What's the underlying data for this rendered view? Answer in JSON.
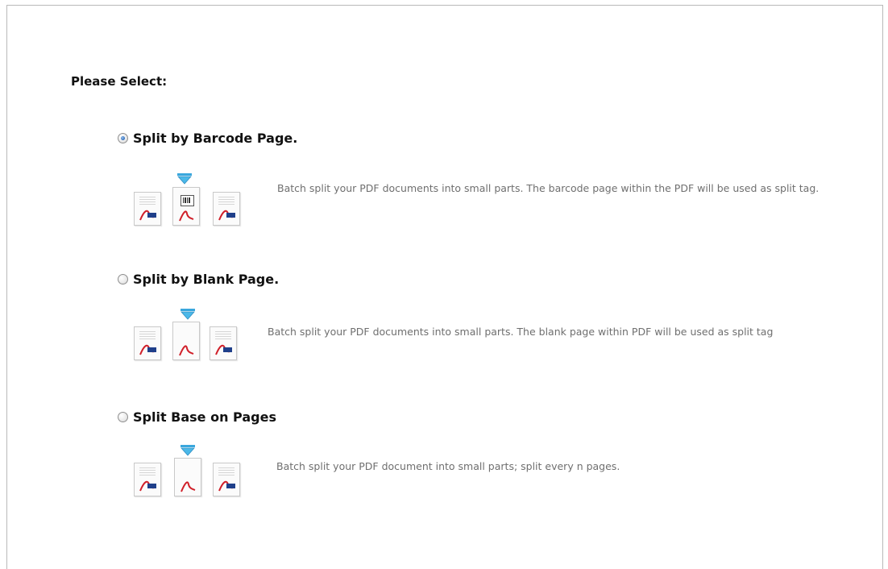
{
  "heading": "Please Select:",
  "options": [
    {
      "label": "Split by Barcode Page.",
      "selected": true,
      "description": "Batch split your PDF documents into small parts. The barcode page within the PDF will be used as split tag.",
      "icon": "barcode-split-illustration"
    },
    {
      "label": "Split by Blank Page.",
      "selected": false,
      "description": "Batch split your PDF documents into small parts. The blank page within PDF will be used as split tag",
      "icon": "blank-page-split-illustration"
    },
    {
      "label": "Split Base on Pages",
      "selected": false,
      "description": "Batch split your PDF document into small parts; split every n pages.",
      "icon": "page-count-split-illustration"
    }
  ],
  "colors": {
    "accent": "#2a67b8",
    "arrow": "#4bb8e8",
    "pdf_red": "#d0202a",
    "text_muted": "#6f6f6f"
  }
}
